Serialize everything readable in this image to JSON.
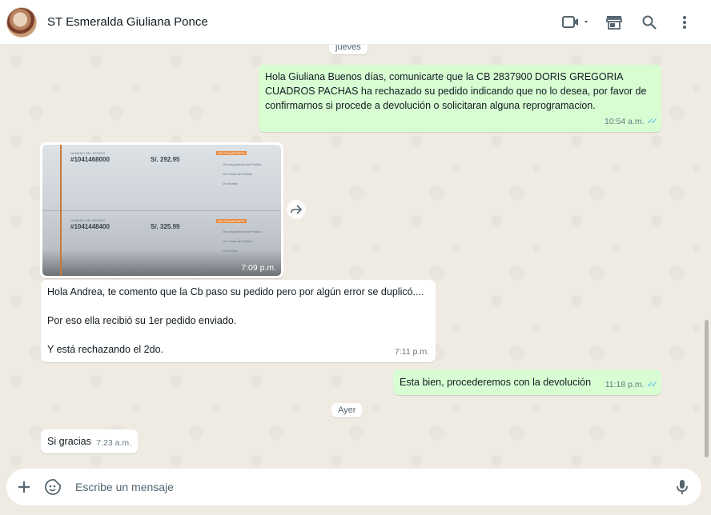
{
  "header": {
    "contact_name": "ST Esmeralda Giuliana Ponce"
  },
  "icons": {
    "video": "video-camera-icon",
    "shop": "storefront-icon",
    "search": "search-icon",
    "menu": "kebab-menu-icon"
  },
  "day_labels": {
    "first": "jueves",
    "second": "Ayer"
  },
  "messages": {
    "m1": {
      "text": "Hola Giuliana Buenos días, comunicarte que la CB  2837900 DORIS GREGORIA CUADROS PACHAS  ha rechazado su pedido indicando que no lo desea, por favor de confirmarnos si procede a devolución o solicitaran alguna reprogramacion.",
      "time": "10:54 a.m."
    },
    "image": {
      "time": "7:09 p.m.",
      "order1_label": "NUMERO DEL PEDIDO",
      "order1_number": "#1041468000",
      "order1_total": "S/. 292.95",
      "order2_label": "NUMERO DEL PEDIDO",
      "order2_number": "#1041448400",
      "order2_total": "S/. 325.99",
      "status": "EN TRANSPORTE",
      "link1": "Ver seguimiento del Pedido",
      "link2": "Ver Venta del Pedido",
      "link3": "Ver Boleta"
    },
    "m2": {
      "line1": "Hola Andrea, te comento que la Cb paso su pedido pero por algún error se duplicó....",
      "line2": "Por eso ella recibió su 1er pedido enviado.",
      "line3": "Y está rechazando el 2do.",
      "time": "7:11 p.m."
    },
    "m3": {
      "text": "Esta bien, procederemos con la devolución",
      "time": "11:18 p.m."
    },
    "m4": {
      "text": "Si gracias",
      "time": "7:23 a.m."
    }
  },
  "composer": {
    "placeholder": "Escribe un mensaje"
  },
  "colors": {
    "outgoing": "#d9fdd3",
    "incoming": "#ffffff",
    "read_ticks": "#53bdeb",
    "chat_bg": "#efeae2"
  }
}
